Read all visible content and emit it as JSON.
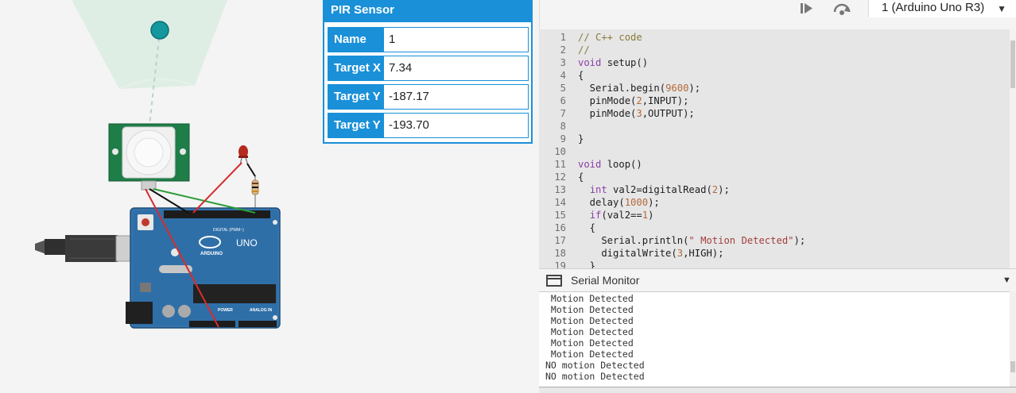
{
  "pir_panel": {
    "title": "PIR Sensor",
    "fields": [
      {
        "label": "Name",
        "value": "1"
      },
      {
        "label": "Target X",
        "value": "7.34"
      },
      {
        "label": "Target Y",
        "value": "-187.17"
      },
      {
        "label": "Target Y",
        "value": "-193.70"
      }
    ]
  },
  "toolbar": {
    "step_icon": "step-forward-icon",
    "debug_icon": "debugger-icon",
    "device_select": "1 (Arduino Uno R3)"
  },
  "code": {
    "line_numbers": [
      "1",
      "2",
      "3",
      "4",
      "5",
      "6",
      "7",
      "8",
      "9",
      "10",
      "11",
      "12",
      "13",
      "14",
      "15",
      "16",
      "17",
      "18",
      "19"
    ]
  },
  "serial_monitor": {
    "title": "Serial Monitor",
    "lines": [
      " Motion Detected",
      " Motion Detected",
      " Motion Detected",
      " Motion Detected",
      " Motion Detected",
      " Motion Detected",
      "NO motion Detected",
      "NO motion Detected"
    ]
  },
  "board": {
    "brand": "ARDUINO",
    "model": "UNO",
    "digital_label": "DIGITAL (PWM~)",
    "power_label": "POWER",
    "analog_label": "ANALOG IN"
  },
  "colors": {
    "accent": "#1a90d8",
    "board": "#2f6fa8",
    "pir_board": "#1f7d48"
  }
}
